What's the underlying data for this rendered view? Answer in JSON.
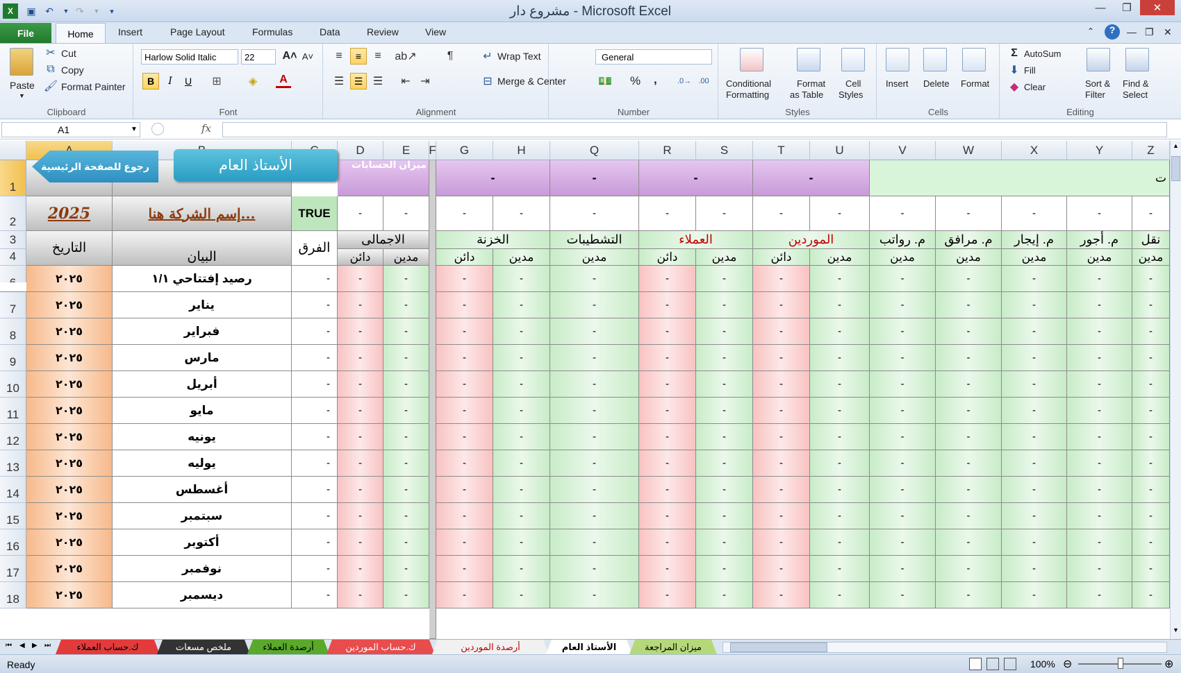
{
  "window": {
    "title": "مشروع دار - Microsoft Excel"
  },
  "ribbon_tabs": {
    "file": "File",
    "home": "Home",
    "insert": "Insert",
    "page_layout": "Page Layout",
    "formulas": "Formulas",
    "data": "Data",
    "review": "Review",
    "view": "View"
  },
  "clipboard": {
    "paste": "Paste",
    "cut": "Cut",
    "copy": "Copy",
    "format_painter": "Format Painter",
    "label": "Clipboard"
  },
  "font": {
    "name": "Harlow Solid Italic",
    "size": "22",
    "label": "Font",
    "bold": "B",
    "italic": "I",
    "underline": "U"
  },
  "alignment": {
    "wrap_text": "Wrap Text",
    "merge_center": "Merge & Center",
    "label": "Alignment"
  },
  "number": {
    "format": "General",
    "label": "Number",
    "percent": "%",
    "comma": ","
  },
  "styles": {
    "conditional": "Conditional",
    "formatting": "Formatting",
    "format": "Format",
    "as_table": "as Table",
    "cell": "Cell",
    "cell_styles": "Styles",
    "label": "Styles"
  },
  "cells": {
    "insert": "Insert",
    "delete": "Delete",
    "format": "Format",
    "label": "Cells"
  },
  "editing": {
    "autosum": "AutoSum",
    "fill": "Fill",
    "clear": "Clear",
    "sort": "Sort &",
    "filter": "Filter",
    "find": "Find &",
    "select": "Select",
    "label": "Editing"
  },
  "formula_bar": {
    "name_box": "A1",
    "fx": "fx"
  },
  "columns": [
    "A",
    "B",
    "C",
    "D",
    "E",
    "F",
    "G",
    "H",
    "Q",
    "R",
    "S",
    "T",
    "U",
    "V",
    "W",
    "X",
    "Y",
    "Z"
  ],
  "row_numbers": [
    "1",
    "2",
    "3",
    "4",
    "6",
    "7",
    "8",
    "9",
    "10",
    "11",
    "12",
    "13",
    "14",
    "15",
    "16",
    "17",
    "18"
  ],
  "sheet": {
    "back_button": "رجوع للصفحة الرئيسية",
    "general_ledger": "الأستاذ العام",
    "trial_balance": "ميزان الحسابات",
    "year": "2025",
    "company_placeholder": "إسم الشركة هنا...",
    "true_value": "TRUE",
    "dash": "-",
    "date_header": "التاريخ",
    "desc_header": "البيان",
    "diff_header": "الفرق",
    "total_header": "الاجمالى",
    "cash_header": "الخزنة",
    "finishing_header": "التشطيبات",
    "clients_header": "العملاء",
    "suppliers_header": "الموردين",
    "salaries_header": "م. رواتب",
    "utilities_header": "م. مرافق",
    "rent_header": "م. إيجار",
    "wages_header": "م. أجور",
    "transport_header": "نقل",
    "credit": "دائن",
    "debit": "مدين",
    "partial_t": "ت",
    "date_value": "٢٠٢٥",
    "months": [
      "رصيد إفتتاحي ١/١",
      "يناير",
      "فبراير",
      "مارس",
      "أبريل",
      "مايو",
      "يونيه",
      "يوليه",
      "أغسطس",
      "سبتمبر",
      "أكتوبر",
      "نوفمبر",
      "ديسمبر"
    ]
  },
  "sheet_tabs": [
    "ك.حساب العملاء",
    "ملخص مسعات",
    "أرصدة العملاء",
    "ك.حساب الموردين",
    "أرصدة الموردين",
    "الأستاذ العام",
    "ميزان المراجعة"
  ],
  "status": {
    "ready": "Ready",
    "zoom": "100%"
  },
  "colors": {
    "file_tab": "#1f7a2c",
    "accent_cyan": "#3aa7c9",
    "purple_header": "#c79ad8",
    "date_orange": "#f7b98a"
  }
}
